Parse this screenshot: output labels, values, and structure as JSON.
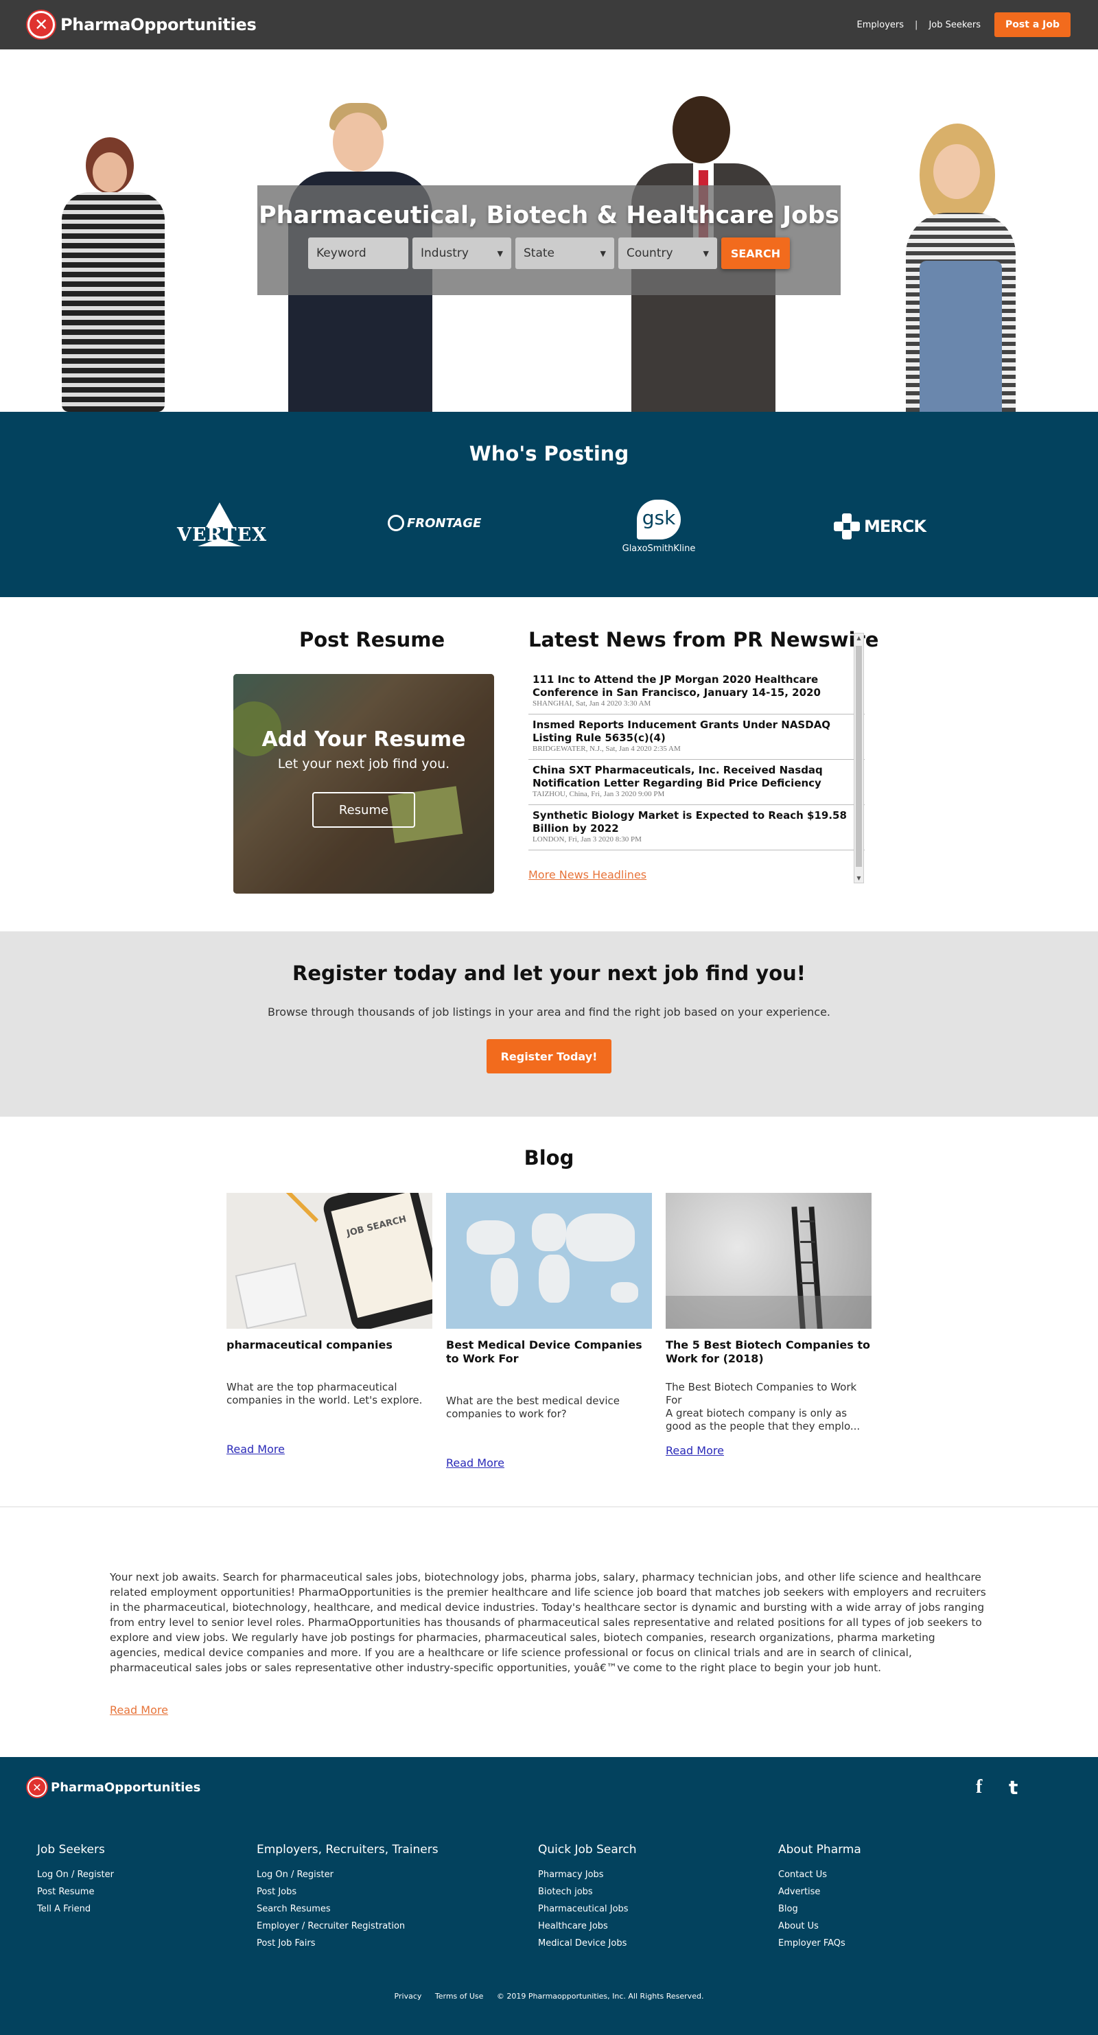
{
  "header": {
    "brand": "PharmaOpportunities",
    "nav": {
      "employers": "Employers",
      "separator": "|",
      "job_seekers": "Job Seekers",
      "post_job": "Post a Job"
    }
  },
  "hero": {
    "title": "Pharmaceutical, Biotech & Healthcare Jobs",
    "keyword_placeholder": "Keyword",
    "industry": "Industry",
    "state": "State",
    "country": "Country",
    "search": "SEARCH"
  },
  "posting": {
    "title": "Who's Posting",
    "logos": {
      "vertex": "VERTEX",
      "frontage": "FRONTAGE",
      "gsk": "gsk",
      "gsk_name": "GlaxoSmithKline",
      "merck": "MERCK"
    }
  },
  "resume": {
    "title": "Post Resume",
    "card_title": "Add Your Resume",
    "card_sub": "Let your next job find you.",
    "button": "Resume"
  },
  "news": {
    "title": "Latest News from PR Newswire",
    "items": [
      {
        "headline": "111 Inc to Attend the JP Morgan 2020 Healthcare Conference in San Francisco, January 14-15, 2020",
        "meta": "SHANGHAI, Sat, Jan 4 2020 3:30 AM"
      },
      {
        "headline": "Insmed Reports Inducement Grants Under NASDAQ Listing Rule 5635(c)(4)",
        "meta": "BRIDGEWATER, N.J., Sat, Jan 4 2020 2:35 AM"
      },
      {
        "headline": "China SXT Pharmaceuticals, Inc. Received Nasdaq Notification Letter Regarding Bid Price Deficiency",
        "meta": "TAIZHOU, China, Fri, Jan 3 2020 9:00 PM"
      },
      {
        "headline": "Synthetic Biology Market is Expected to Reach $19.58 Billion by 2022",
        "meta": "LONDON, Fri, Jan 3 2020 8:30 PM"
      }
    ],
    "more": "More News Headlines"
  },
  "register": {
    "title": "Register today and let your next job find you!",
    "text": "Browse through thousands of job listings in your area and find the right job based on your experience.",
    "button": "Register Today!"
  },
  "blog": {
    "title": "Blog",
    "posts": [
      {
        "title": "pharmaceutical companies",
        "excerpt": "What are the top pharmaceutical companies in the world. Let's explore.",
        "read_more": "Read More",
        "image_text": "JOB SEARCH"
      },
      {
        "title": "Best Medical Device Companies to Work For",
        "excerpt": "What are the best medical device companies to work for?",
        "read_more": "Read More"
      },
      {
        "title": "The 5 Best Biotech Companies to Work for (2018)",
        "excerpt": "The Best Biotech Companies to Work For\nA great biotech company is only as good as the people that they emplo...",
        "read_more": "Read More"
      }
    ]
  },
  "seo": {
    "text": "Your next job awaits. Search for pharmaceutical sales jobs, biotechnology jobs, pharma jobs, salary, pharmacy technician jobs, and other life science and healthcare related employment opportunities! PharmaOpportunities is the premier healthcare and life science job board that matches job seekers with employers and recruiters in the pharmaceutical, biotechnology, healthcare, and medical device industries. Today's healthcare sector is dynamic and bursting with a wide array of jobs ranging from entry level to senior level roles. PharmaOpportunities has thousands of pharmaceutical sales representative and related positions for all types of job seekers to explore and view jobs. We regularly have job postings for pharmacies, pharmaceutical sales, biotech companies, research organizations, pharma marketing agencies, medical device companies and more. If you are a healthcare or life science professional or focus on clinical trials and are in search of clinical, pharmaceutical sales jobs or sales representative other industry-specific opportunities, youâ€™ve come to the right place to begin your job hunt.",
    "read_more": "Read More"
  },
  "footer": {
    "brand": "PharmaOpportunities",
    "social": {
      "facebook": "f",
      "twitter": "t"
    },
    "columns": [
      {
        "title": "Job Seekers",
        "links": [
          "Log On / Register",
          "Post Resume",
          "Tell A Friend"
        ]
      },
      {
        "title": "Employers, Recruiters, Trainers",
        "links": [
          "Log On / Register",
          "Post Jobs",
          "Search Resumes",
          "Employer / Recruiter Registration",
          "Post Job Fairs"
        ]
      },
      {
        "title": "Quick Job Search",
        "links": [
          "Pharmacy Jobs",
          "Biotech jobs",
          "Pharmaceutical Jobs",
          "Healthcare Jobs",
          "Medical Device Jobs"
        ]
      },
      {
        "title": "About Pharma",
        "links": [
          "Contact Us",
          "Advertise",
          "Blog",
          "About Us",
          "Employer FAQs"
        ]
      }
    ],
    "bottom": {
      "privacy": "Privacy",
      "terms": "Terms of Use",
      "copyright": "© 2019 Pharmaopportunities, Inc. All Rights Reserved."
    }
  },
  "colors": {
    "header_bg": "#3c3c3c",
    "accent": "#f26b1d",
    "navy": "#03425e",
    "logo_red": "#e0322f"
  }
}
